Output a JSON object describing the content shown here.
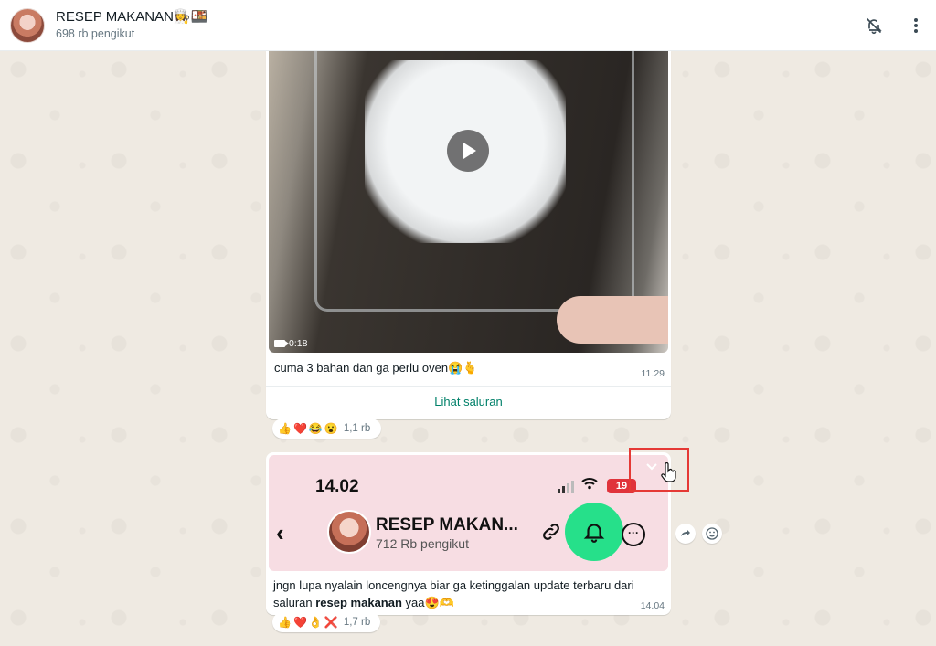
{
  "header": {
    "channel_name": "RESEP MAKANAN👩‍🍳🍱",
    "followers": "698 rb pengikut",
    "mute_icon": "bell-off-icon",
    "menu_icon": "kebab-menu-icon"
  },
  "message1": {
    "video_duration": "0:18",
    "caption": "cuma 3 bahan dan ga perlu oven😭🫰",
    "time": "11.29",
    "view_channel_label": "Lihat saluran",
    "reactions": {
      "emojis": [
        "👍",
        "❤️",
        "😂",
        "😮"
      ],
      "count": "1,1 rb"
    }
  },
  "message2": {
    "image": {
      "phone_time": "14.02",
      "battery": "19",
      "channel_name": "RESEP MAKAN...",
      "channel_followers": "712 Rb pengikut"
    },
    "caption_before": "jngn lupa nyalain loncengnya biar ga ketinggalan update terbaru dari saluran ",
    "caption_bold": "resep makanan",
    "caption_after": " yaa😍🫶",
    "time": "14.04",
    "reactions": {
      "emojis": [
        "👍",
        "❤️",
        "👌",
        "❌"
      ],
      "count": "1,7 rb"
    }
  },
  "colors": {
    "accent": "#008069",
    "chat_bg": "#efeae2",
    "highlight_green": "#26e08a",
    "annotation_red": "#e53935"
  }
}
